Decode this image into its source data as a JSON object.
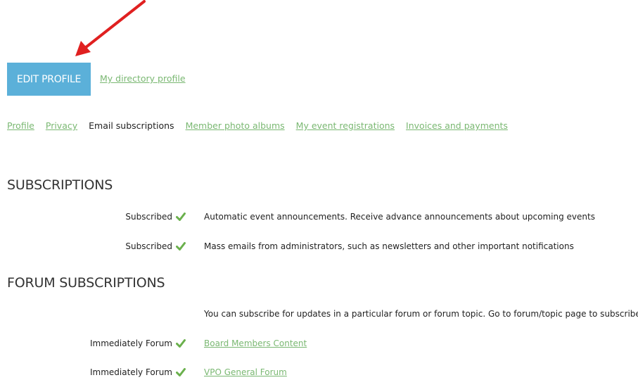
{
  "header": {
    "edit_button_label": "EDIT PROFILE",
    "directory_link": "My directory profile"
  },
  "tabs": [
    {
      "label": "Profile",
      "active": false
    },
    {
      "label": "Privacy",
      "active": false
    },
    {
      "label": "Email subscriptions",
      "active": true
    },
    {
      "label": "Member photo albums",
      "active": false
    },
    {
      "label": "My event registrations",
      "active": false
    },
    {
      "label": "Invoices and payments",
      "active": false
    }
  ],
  "subscriptions": {
    "heading": "SUBSCRIPTIONS",
    "items": [
      {
        "status": "Subscribed",
        "text": "Automatic event announcements. Receive advance announcements about upcoming events"
      },
      {
        "status": "Subscribed",
        "text": "Mass emails from administrators, such as newsletters and other important notifications"
      }
    ]
  },
  "forum": {
    "heading": "FORUM SUBSCRIPTIONS",
    "note": "You can subscribe for updates in a particular forum or forum topic. Go to forum/topic page to subscribe.",
    "items": [
      {
        "status": "Immediately Forum",
        "link": "Board Members Content"
      },
      {
        "status": "Immediately Forum",
        "link": "VPO General Forum"
      }
    ]
  },
  "icons": {
    "checkmark": "check-icon",
    "annotation": "red-arrow-icon"
  },
  "colors": {
    "button_bg": "#5bb0d9",
    "link": "#7ab872",
    "check": "#6ab04c",
    "arrow": "#e02020"
  }
}
